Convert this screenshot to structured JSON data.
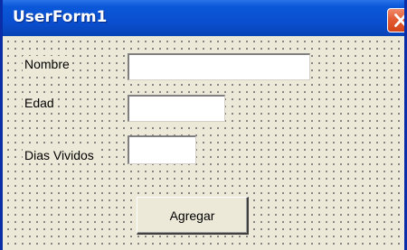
{
  "window": {
    "title": "UserForm1",
    "title_color": "#ffffff",
    "titlebar_color": "#0a58d8",
    "close_button_color": "#e35c34"
  },
  "form": {
    "fields": [
      {
        "label": "Nombre",
        "value": ""
      },
      {
        "label": "Edad",
        "value": ""
      },
      {
        "label": "Dias Vividos",
        "value": ""
      }
    ],
    "button_label": "Agregar"
  },
  "icons": {
    "close": "close-icon"
  }
}
